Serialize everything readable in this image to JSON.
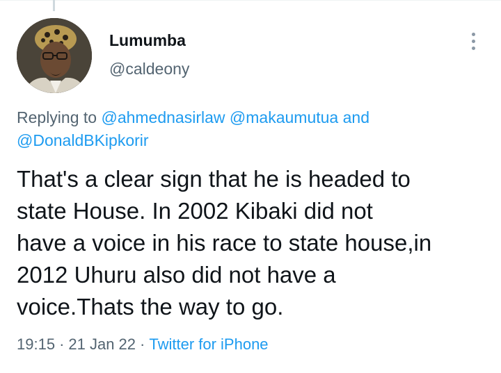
{
  "author": {
    "name": "Lumumba",
    "handle": "@caldeony"
  },
  "reply": {
    "prefix": "Replying to",
    "mention_1": "@ahmednasirlaw",
    "mention_2": "@makaumutua",
    "conjunction": "and",
    "mention_3": "@DonaldBKipkorir"
  },
  "tweet": {
    "text": "That's a clear sign that he is headed to\nstate House. In 2002 Kibaki did not\nhave a voice in his race to state house,in\n2012 Uhuru also did not have a\nvoice.Thats the way to go."
  },
  "meta": {
    "time": "19:15",
    "separator": "·",
    "date": "21 Jan 22",
    "source": "Twitter for iPhone"
  },
  "icons": {
    "more": "more-vertical-icon",
    "avatar": "avatar"
  },
  "colors": {
    "link": "#1d9bf0",
    "secondary_text": "#536471",
    "primary_text": "#0f1419"
  }
}
